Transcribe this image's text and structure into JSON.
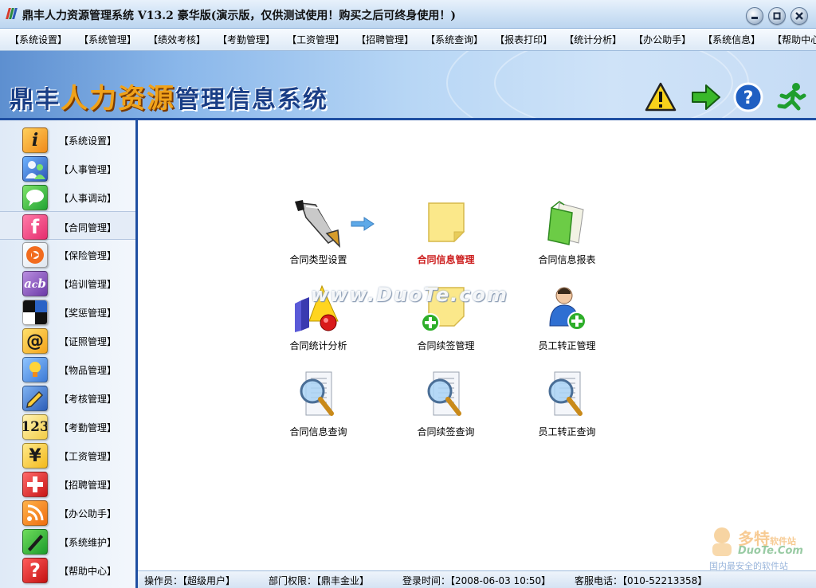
{
  "window": {
    "title": "鼎丰人力资源管理系统 V13.2 豪华版(演示版，仅供测试使用！购买之后可终身使用！)"
  },
  "menubar": {
    "items": [
      "【系统设置】",
      "【系统管理】",
      "【绩效考核】",
      "【考勤管理】",
      "【工资管理】",
      "【招聘管理】",
      "【系统查询】",
      "【报表打印】",
      "【统计分析】",
      "【办公助手】",
      "【系统信息】",
      "【帮助中心】"
    ]
  },
  "banner": {
    "title_part1": "鼎丰",
    "title_part2": "人力资源",
    "title_part3": "管理信息系统",
    "icons": [
      "warning-icon",
      "arrow-right-icon",
      "help-icon",
      "exit-runner-icon"
    ]
  },
  "sidebar": {
    "items": [
      {
        "label": "【系统设置】",
        "icon": "info-icon",
        "active": false
      },
      {
        "label": "【人事管理】",
        "icon": "people-icon",
        "active": false
      },
      {
        "label": "【人事调动】",
        "icon": "chat-icon",
        "active": false
      },
      {
        "label": "【合同管理】",
        "icon": "facebook-f-icon",
        "active": true
      },
      {
        "label": "【保险管理】",
        "icon": "lifebuoy-icon",
        "active": false
      },
      {
        "label": "【培训管理】",
        "icon": "abc-icon",
        "active": false
      },
      {
        "label": "【奖惩管理】",
        "icon": "blocks-icon",
        "active": false
      },
      {
        "label": "【证照管理】",
        "icon": "at-icon",
        "active": false
      },
      {
        "label": "【物品管理】",
        "icon": "bulb-icon",
        "active": false
      },
      {
        "label": "【考核管理】",
        "icon": "pencil-icon",
        "active": false
      },
      {
        "label": "【考勤管理】",
        "icon": "numbers-icon",
        "active": false
      },
      {
        "label": "【工资管理】",
        "icon": "yen-icon",
        "active": false
      },
      {
        "label": "【招聘管理】",
        "icon": "red-cross-icon",
        "active": false
      },
      {
        "label": "【办公助手】",
        "icon": "rss-icon",
        "active": false
      },
      {
        "label": "【系统维护】",
        "icon": "pen-icon",
        "active": false
      },
      {
        "label": "【帮助中心】",
        "icon": "question-icon",
        "active": false
      }
    ]
  },
  "main": {
    "grid": [
      {
        "label": "合同类型设置",
        "icon": "fountain-pen-icon",
        "current": false
      },
      {
        "label": "合同信息管理",
        "icon": "sticky-note-icon",
        "current": true
      },
      {
        "label": "合同信息报表",
        "icon": "green-folder-icon",
        "current": false
      },
      {
        "label": "合同统计分析",
        "icon": "shapes-icon",
        "current": false
      },
      {
        "label": "合同续签管理",
        "icon": "note-add-icon",
        "current": false
      },
      {
        "label": "员工转正管理",
        "icon": "user-add-icon",
        "current": false
      },
      {
        "label": "合同信息查询",
        "icon": "document-search-icon",
        "current": false
      },
      {
        "label": "合同续签查询",
        "icon": "document-search-icon",
        "current": false
      },
      {
        "label": "员工转正查询",
        "icon": "document-search-icon",
        "current": false
      }
    ],
    "watermark": "www.DuoTe.com",
    "brand": {
      "line1": "多特",
      "line1_small": "软件站",
      "line2": "DuoTe.Com",
      "line3": "国内最安全的软件站"
    }
  },
  "statusbar": {
    "operator": "操作员：【超级用户】",
    "department": "部门权限：【鼎丰金业】",
    "login_time": "登录时间：【2008-06-03 10:50】",
    "service_phone": "客服电话：【010-52213358】"
  }
}
